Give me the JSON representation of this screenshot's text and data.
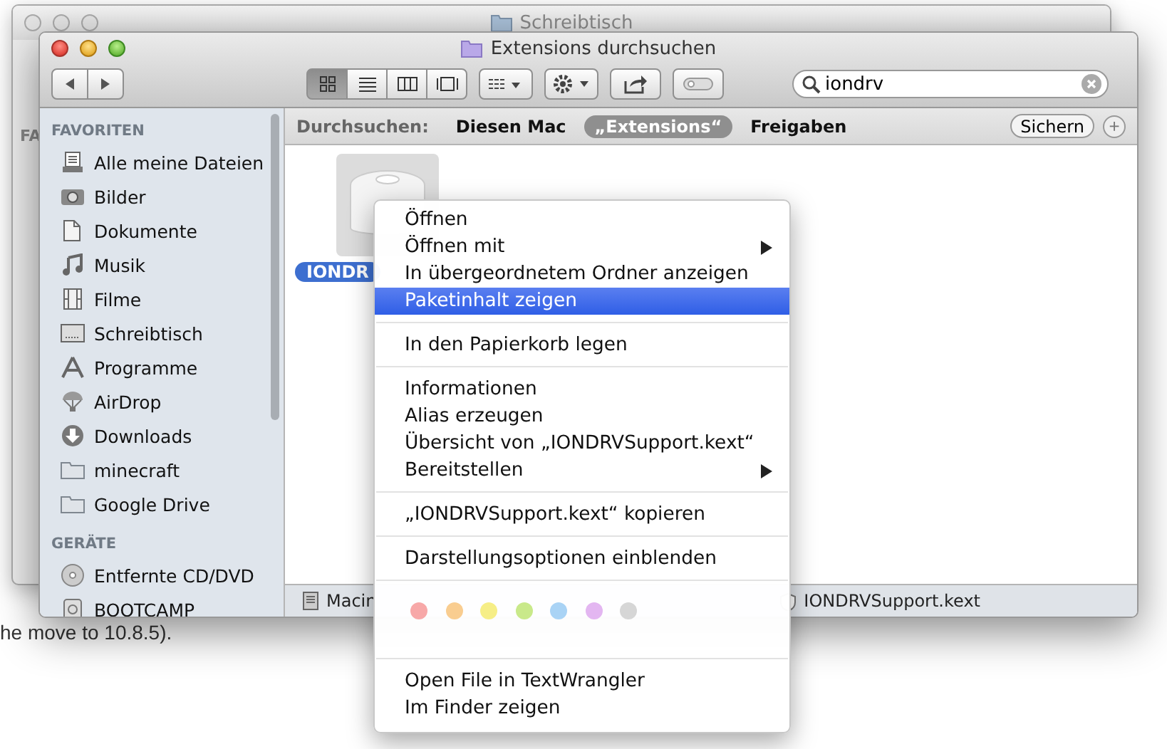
{
  "page_text": "he move to 10.8.5).",
  "back_window": {
    "title": "Schreibtisch",
    "sidebar_heading": "FA"
  },
  "window": {
    "title": "Extensions durchsuchen",
    "view_buttons": [
      {
        "selected": true
      },
      {
        "selected": false
      },
      {
        "selected": false
      },
      {
        "selected": false
      }
    ],
    "search": {
      "value": "iondrv"
    },
    "scope_bar": {
      "label": "Durchsuchen:",
      "scopes": [
        {
          "label": "Diesen Mac",
          "selected": false
        },
        {
          "label": "„Extensions“",
          "selected": true
        },
        {
          "label": "Freigaben",
          "selected": false
        }
      ],
      "save_button": "Sichern",
      "add_button": "+"
    },
    "sidebar": [
      {
        "heading": "FAVORITEN",
        "items": [
          {
            "label": "Alle meine Dateien"
          },
          {
            "label": "Bilder"
          },
          {
            "label": "Dokumente"
          },
          {
            "label": "Musik"
          },
          {
            "label": "Filme"
          },
          {
            "label": "Schreibtisch"
          },
          {
            "label": "Programme"
          },
          {
            "label": "AirDrop"
          },
          {
            "label": "Downloads"
          },
          {
            "label": "minecraft"
          },
          {
            "label": "Google Drive"
          }
        ]
      },
      {
        "heading": "GERÄTE",
        "items": [
          {
            "label": "Entfernte CD/DVD"
          },
          {
            "label": "BOOTCAMP"
          }
        ]
      }
    ],
    "files": [
      {
        "name": "IONDR",
        "selected": true
      }
    ],
    "path_bar": [
      {
        "label": "Macin"
      },
      {
        "label": "IONDRVSupport.kext"
      }
    ]
  },
  "context_menu": {
    "groups": [
      [
        {
          "label": "Öffnen",
          "submenu": false,
          "selected": false
        },
        {
          "label": "Öffnen mit",
          "submenu": true,
          "selected": false
        },
        {
          "label": "In übergeordnetem Ordner anzeigen",
          "submenu": false,
          "selected": false
        },
        {
          "label": "Paketinhalt zeigen",
          "submenu": false,
          "selected": true
        }
      ],
      [
        {
          "label": "In den Papierkorb legen",
          "submenu": false,
          "selected": false
        }
      ],
      [
        {
          "label": "Informationen",
          "submenu": false,
          "selected": false
        },
        {
          "label": "Alias erzeugen",
          "submenu": false,
          "selected": false
        },
        {
          "label": "Übersicht von „IONDRVSupport.kext“",
          "submenu": false,
          "selected": false
        },
        {
          "label": "Bereitstellen",
          "submenu": true,
          "selected": false
        }
      ],
      [
        {
          "label": "„IONDRVSupport.kext“ kopieren",
          "submenu": false,
          "selected": false
        }
      ],
      [
        {
          "label": "Darstellungsoptionen einblenden",
          "submenu": false,
          "selected": false
        }
      ]
    ],
    "tags": [
      {
        "color": "#f7a8a8"
      },
      {
        "color": "#f9cd90"
      },
      {
        "color": "#f6ee86"
      },
      {
        "color": "#c9e98a"
      },
      {
        "color": "#a9d3f5"
      },
      {
        "color": "#e3b6f1"
      },
      {
        "color": "#d6d6d6"
      }
    ],
    "service_items": [
      {
        "label": "Open File in TextWrangler"
      },
      {
        "label": "Im Finder zeigen"
      }
    ]
  }
}
